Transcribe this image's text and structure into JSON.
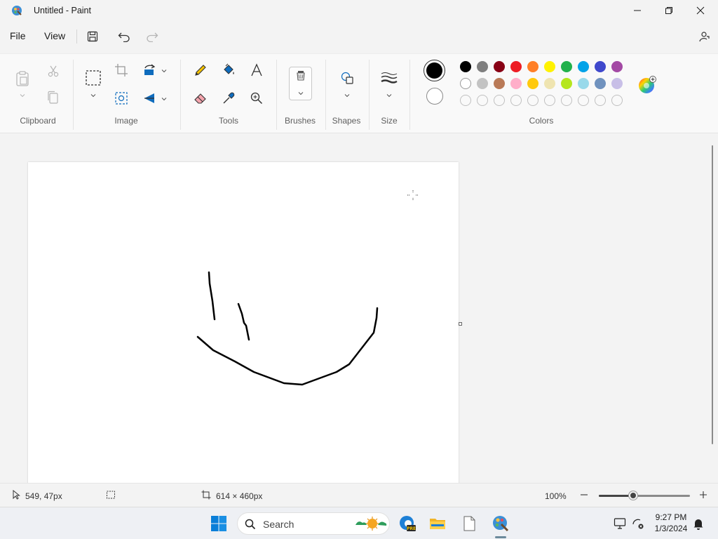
{
  "window": {
    "title": "Untitled - Paint",
    "controls": [
      "minimize",
      "maximize",
      "close"
    ]
  },
  "menu": {
    "file_label": "File",
    "view_label": "View",
    "icons": [
      "save-icon",
      "undo-icon",
      "redo-icon",
      "share-icon"
    ]
  },
  "ribbon": {
    "groups": {
      "clipboard": "Clipboard",
      "image": "Image",
      "tools": "Tools",
      "brushes": "Brushes",
      "shapes": "Shapes",
      "size": "Size",
      "colors": "Colors"
    },
    "primary_color": "#000000",
    "secondary_color": "#ffffff",
    "palette_row1": [
      "#000000",
      "#7f7f7f",
      "#880015",
      "#ed1c24",
      "#ff7f27",
      "#fff200",
      "#22b14c",
      "#00a2e8",
      "#3f48cc",
      "#a349a4"
    ],
    "palette_row2": [
      "#ffffff",
      "#c3c3c3",
      "#b97a57",
      "#ffaec9",
      "#ffc90e",
      "#efe4b0",
      "#b5e61d",
      "#99d9ea",
      "#7092be",
      "#c8bfe7"
    ],
    "palette_row3_empty_count": 10
  },
  "status": {
    "cursor_position": "549, 47px",
    "canvas_size": "614 × 460px",
    "zoom": "100%",
    "zoom_fraction": 0.38
  },
  "taskbar": {
    "search_label": "Search",
    "time": "9:27 PM",
    "date": "1/3/2024",
    "icons": [
      "windows-start-icon",
      "search-icon",
      "weather-widget-icon",
      "edge-beta-icon",
      "file-explorer-icon",
      "notepad-icon",
      "paint-icon",
      "display-icon",
      "network-off-icon",
      "notification-bell-icon"
    ]
  }
}
